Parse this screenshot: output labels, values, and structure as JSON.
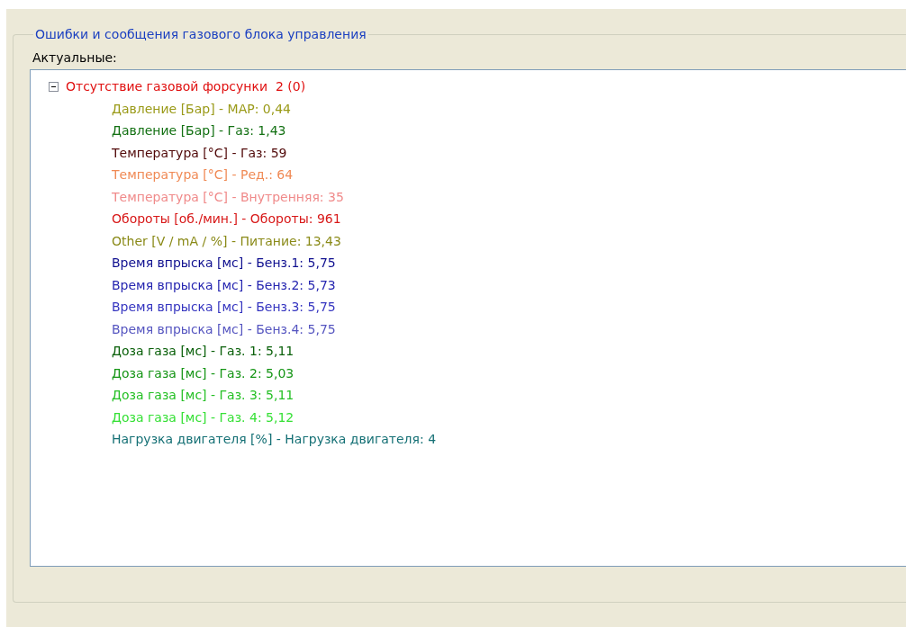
{
  "group": {
    "title": "Ошибки и сообщения газового блока управления"
  },
  "list_label": "Актуальные:",
  "tree": [
    {
      "label": "Отсутствие газовой форсунки  2 (0)",
      "color": "#e01010",
      "expanded": true,
      "children": [
        {
          "label": "Давление [Бар] - MAP: 0,44",
          "color": "#9a9a18"
        },
        {
          "label": "Давление [Бар] - Газ: 1,43",
          "color": "#127012"
        },
        {
          "label": "Температура [°C] - Газ: 59",
          "color": "#500808"
        },
        {
          "label": "Температура [°C] - Ред.: 64",
          "color": "#f08a55"
        },
        {
          "label": "Температура [°C] - Внутренняя: 35",
          "color": "#f08a8a"
        },
        {
          "label": "Обороты [об./мин.] - Обороты: 961",
          "color": "#d81818"
        },
        {
          "label": "Other [V / mA / %] - Питание: 13,43",
          "color": "#8a8a18"
        },
        {
          "label": "Время впрыска [мс] - Бенз.1: 5,75",
          "color": "#101090"
        },
        {
          "label": "Время впрыска [мс] - Бенз.2: 5,73",
          "color": "#2525b0"
        },
        {
          "label": "Время впрыска [мс] - Бенз.3: 5,75",
          "color": "#3535c0"
        },
        {
          "label": "Время впрыска [мс] - Бенз.4: 5,75",
          "color": "#5555c0"
        },
        {
          "label": "Доза газа [мс] - Газ. 1: 5,11",
          "color": "#0a600a"
        },
        {
          "label": "Доза газа [мс] - Газ. 2: 5,03",
          "color": "#159515"
        },
        {
          "label": "Доза газа [мс] - Газ. 3: 5,11",
          "color": "#25c025"
        },
        {
          "label": "Доза газа [мс] - Газ. 4: 5,12",
          "color": "#35e035"
        },
        {
          "label": "Нагрузка двигателя [%] - Нагрузка двигателя: 4",
          "color": "#157075"
        }
      ]
    }
  ]
}
